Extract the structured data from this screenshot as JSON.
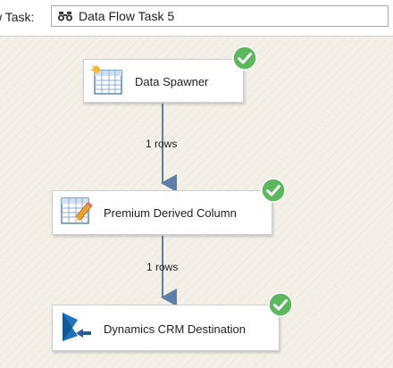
{
  "header": {
    "task_label": "w Task:",
    "selected_task": "Data Flow Task 5"
  },
  "components": {
    "source": {
      "label": "Data Spawner",
      "status": "success"
    },
    "transform": {
      "label": "Premium Derived Column",
      "status": "success"
    },
    "destination": {
      "label": "Dynamics CRM Destination",
      "status": "success"
    }
  },
  "paths": [
    {
      "label": "1 rows"
    },
    {
      "label": "1 rows"
    }
  ],
  "colors": {
    "connector": "#5b7fa8",
    "success": "#5cb85c",
    "canvas": "#f4f0e8"
  },
  "icons": {
    "task": "binoculars-icon",
    "source": "spreadsheet-sun-icon",
    "transform": "spreadsheet-pencil-icon",
    "destination": "dynamics-crm-icon",
    "status": "check-circle-icon"
  }
}
